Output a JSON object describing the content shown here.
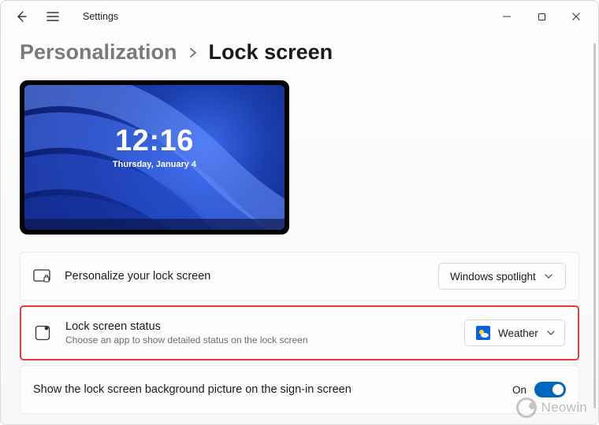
{
  "app": {
    "title": "Settings"
  },
  "breadcrumb": {
    "parent": "Personalization",
    "current": "Lock screen"
  },
  "preview": {
    "time": "12:16",
    "date": "Thursday, January 4"
  },
  "rows": {
    "personalize": {
      "title": "Personalize your lock screen",
      "dropdown": "Windows spotlight"
    },
    "status": {
      "title": "Lock screen status",
      "subtitle": "Choose an app to show detailed status on the lock screen",
      "dropdown": "Weather"
    },
    "signin_pic": {
      "label": "Show the lock screen background picture on the sign-in screen",
      "state": "On"
    }
  },
  "watermark": {
    "text": "Neowin"
  }
}
